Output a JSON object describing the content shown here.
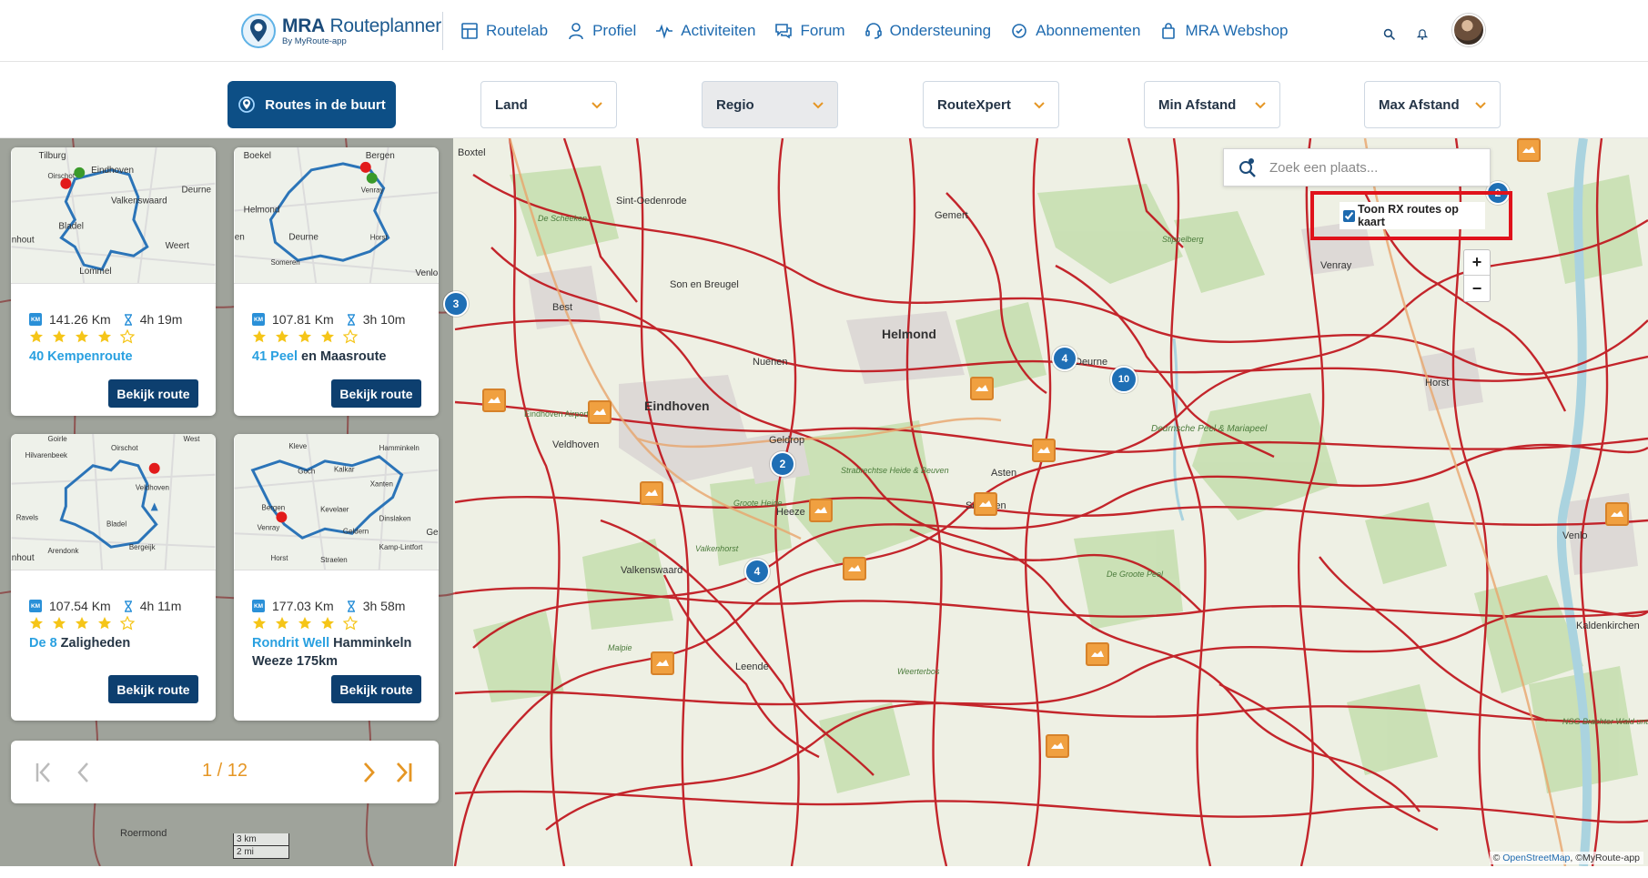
{
  "brand": {
    "title_bold": "MRA",
    "title_rest": " Routeplanner",
    "subtitle": "By MyRoute-app"
  },
  "nav": [
    {
      "label": "Routelab",
      "icon": "map-grid-icon"
    },
    {
      "label": "Profiel",
      "icon": "user-icon"
    },
    {
      "label": "Activiteiten",
      "icon": "activity-icon"
    },
    {
      "label": "Forum",
      "icon": "chat-icon"
    },
    {
      "label": "Ondersteuning",
      "icon": "headset-icon"
    },
    {
      "label": "Abonnementen",
      "icon": "subscription-icon"
    },
    {
      "label": "MRA Webshop",
      "icon": "shopping-bag-icon"
    }
  ],
  "filters": {
    "nearby_label": "Routes in de buurt",
    "land": "Land",
    "regio": "Regio",
    "routexpert": "RouteXpert",
    "min_afstand": "Min Afstand",
    "max_afstand": "Max Afstand"
  },
  "map": {
    "search_placeholder": "Zoek een plaats...",
    "rx_toggle_label": "Toon RX routes op kaart",
    "rx_toggle_checked": true,
    "zoom_in": "+",
    "zoom_out": "−",
    "scale_km": "3 km",
    "scale_mi": "2 mi",
    "attribution_prefix": "© ",
    "attribution_link": "OpenStreetMap",
    "attribution_suffix": ", ©MyRoute-app",
    "place_labels": [
      "Boxtel",
      "Sint-Oedenrode",
      "Gemert",
      "Son en Breugel",
      "Best",
      "Nuenen",
      "Helmond",
      "Deurne",
      "Venray",
      "Horst",
      "Eindhoven",
      "Geldrop",
      "Veldhoven",
      "Asten",
      "Valkenswaard",
      "Someren",
      "Venlo",
      "Kaldenkirchen",
      "Heeze",
      "Leende",
      "Stippelberg",
      "Deurnsche Peel & Mariapeel",
      "Strabrechtse Heide & Beuven",
      "Groote Heide",
      "Valkenhorst",
      "De Groote Peel",
      "Weerterbos",
      "NSG Brachter Wald und Heidemoore",
      "De Scheeken",
      "Eindhoven Airport",
      "Malpie"
    ],
    "clusters": [
      "3",
      "4",
      "10",
      "2",
      "4",
      "2"
    ],
    "route_color": "#c0141c"
  },
  "routes": [
    {
      "km": "141.26 Km",
      "time": "4h 19m",
      "rating": 4,
      "title_hl": "40 Kempenroute",
      "title_rest": "",
      "button": "Bekijk route",
      "thumb_labels": [
        "Tilburg",
        "Oirschot",
        "Eindhoven",
        "Deurne",
        "Bladel",
        "Valkenswaard",
        "Weert",
        "Lommel",
        "nhout"
      ]
    },
    {
      "km": "107.81 Km",
      "time": "3h 10m",
      "rating": 4,
      "title_hl": "41 Peel",
      "title_rest": " en Maasroute",
      "button": "Bekijk route",
      "thumb_labels": [
        "Boekel",
        "Bergen",
        "Venray",
        "Helmond",
        "Deurne",
        "Horst",
        "Someren",
        "Venlo",
        "en"
      ]
    },
    {
      "km": "107.54 Km",
      "time": "4h 11m",
      "rating": 4,
      "title_hl": "De 8",
      "title_rest": " Zaligheden",
      "button": "Bekijk route",
      "thumb_labels": [
        "Goirle",
        "Hilvarenbeek",
        "Oirschot",
        "Veldhoven",
        "Ravels",
        "Bladel",
        "Arendonk",
        "Bergeijk",
        "nhout",
        "West"
      ]
    },
    {
      "km": "177.03 Km",
      "time": "3h 58m",
      "rating": 4,
      "title_hl": "Rondrit Well",
      "title_rest": " Hamminkeln Weeze 175km",
      "button": "Bekijk route",
      "thumb_labels": [
        "Kleve",
        "Hamminkeln",
        "Goch",
        "Kalkar",
        "Kevelaer",
        "Xanten",
        "Bergen",
        "Venray",
        "Dinslaken",
        "Geldern",
        "Kamp-Lintfort",
        "Horst",
        "Straelen",
        "Ge"
      ]
    }
  ],
  "pager": {
    "current": "1 / 12"
  },
  "side_labels": [
    "Roermond",
    "Arendonk"
  ],
  "colors": {
    "primary": "#0d4f86",
    "accent": "#e59624",
    "link": "#1e6aaf",
    "star": "#f5c518"
  }
}
